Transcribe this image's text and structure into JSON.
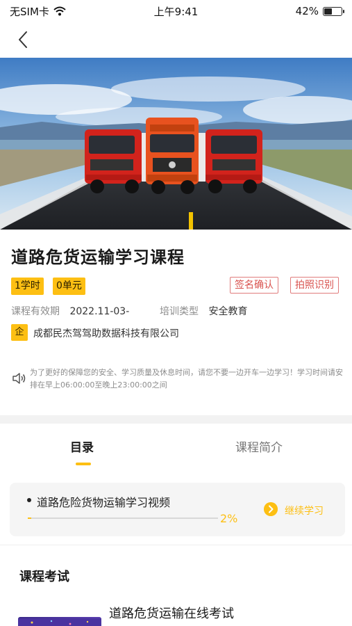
{
  "status_bar": {
    "carrier": "无SIM卡",
    "time": "上午9:41",
    "battery_percent": "42%",
    "battery_level": 0.42
  },
  "nav": {
    "back_icon": "chevron-left-icon"
  },
  "course": {
    "title": "道路危货运输学习课程",
    "hours_tag": "1学时",
    "units_tag": "0单元",
    "sign_confirm": "签名确认",
    "photo_verify": "拍照识别",
    "validity_label": "课程有效期",
    "validity_value": "2022.11-03-",
    "training_type_label": "培训类型",
    "training_type_value": "安全教育",
    "company_badge": "企",
    "company": "成都民杰驾驾助数据科技有限公司",
    "notice": "为了更好的保障您的安全、学习质量及休息时间，请您不要一边开车一边学习！学习时间请安排在早上06:00:00至晚上23:00:00之间"
  },
  "tabs": [
    {
      "label": "目录",
      "active": true
    },
    {
      "label": "课程简介",
      "active": false
    }
  ],
  "lesson": {
    "title": "道路危险货物运输学习视频",
    "progress_text": "2%",
    "progress": 0.02,
    "continue_label": "继续学习"
  },
  "exam": {
    "heading": "课程考试",
    "title": "道路危货运输在线考试"
  },
  "colors": {
    "accent": "#fdbf13",
    "danger": "#d9534f"
  }
}
